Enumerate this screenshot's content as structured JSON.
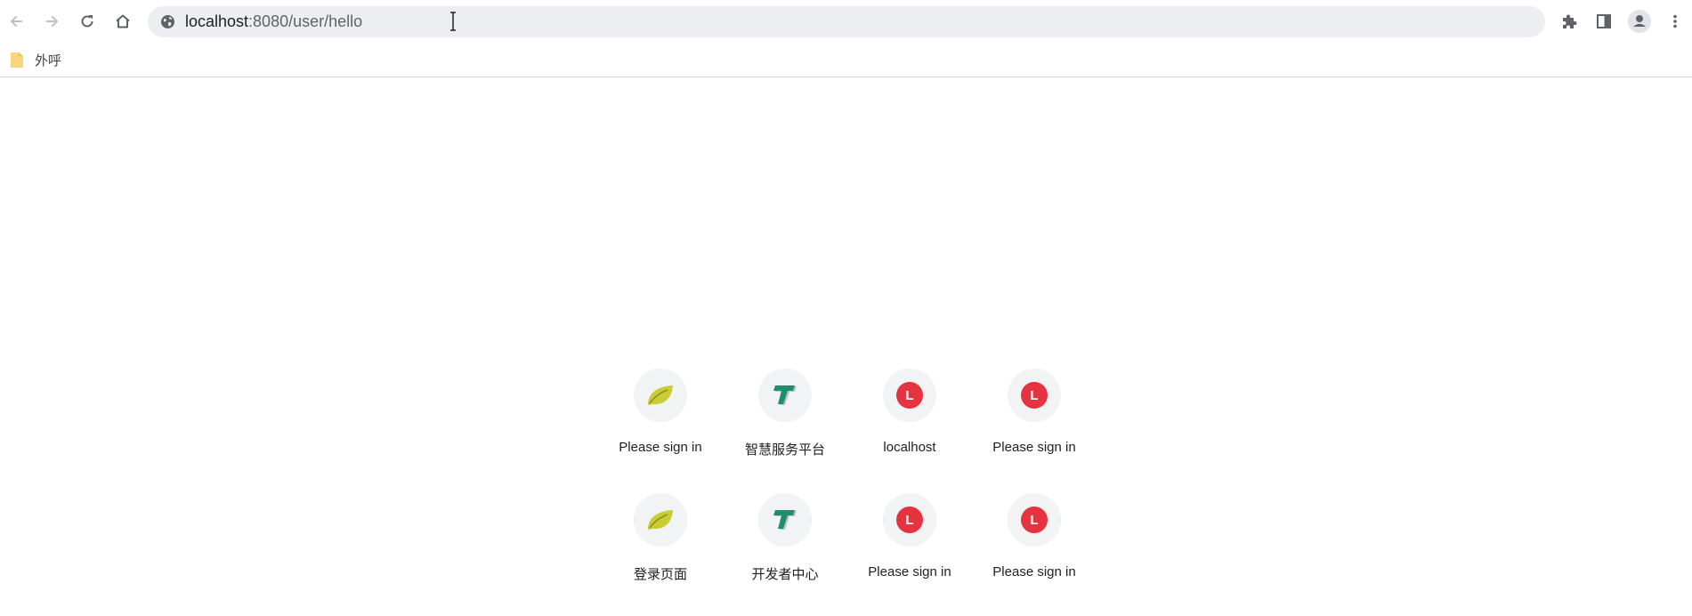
{
  "browser": {
    "url_host": "localhost",
    "url_path": ":8080/user/hello"
  },
  "bookmarks": [
    {
      "label": "外呼"
    }
  ],
  "tiles": [
    {
      "title": "Please sign in",
      "icon": "leaf-icon"
    },
    {
      "title": "智慧服务平台",
      "icon": "green-t-logo-icon"
    },
    {
      "title": "localhost",
      "icon": "letter-l-icon",
      "letter": "L"
    },
    {
      "title": "Please sign in",
      "icon": "letter-l-icon",
      "letter": "L"
    },
    {
      "title": "登录页面",
      "icon": "leaf-icon"
    },
    {
      "title": "开发者中心",
      "icon": "green-t-logo-icon"
    },
    {
      "title": "Please sign in",
      "icon": "letter-l-icon",
      "letter": "L"
    },
    {
      "title": "Please sign in",
      "icon": "letter-l-icon",
      "letter": "L"
    }
  ],
  "colors": {
    "omnibox_bg": "#eceef1",
    "tile_icon_bg": "#f1f3f4",
    "letter_badge": "#e53340",
    "leaf": "#c9cd33",
    "t_logo": "#1e8e6e",
    "folder": "#f7d67d"
  }
}
